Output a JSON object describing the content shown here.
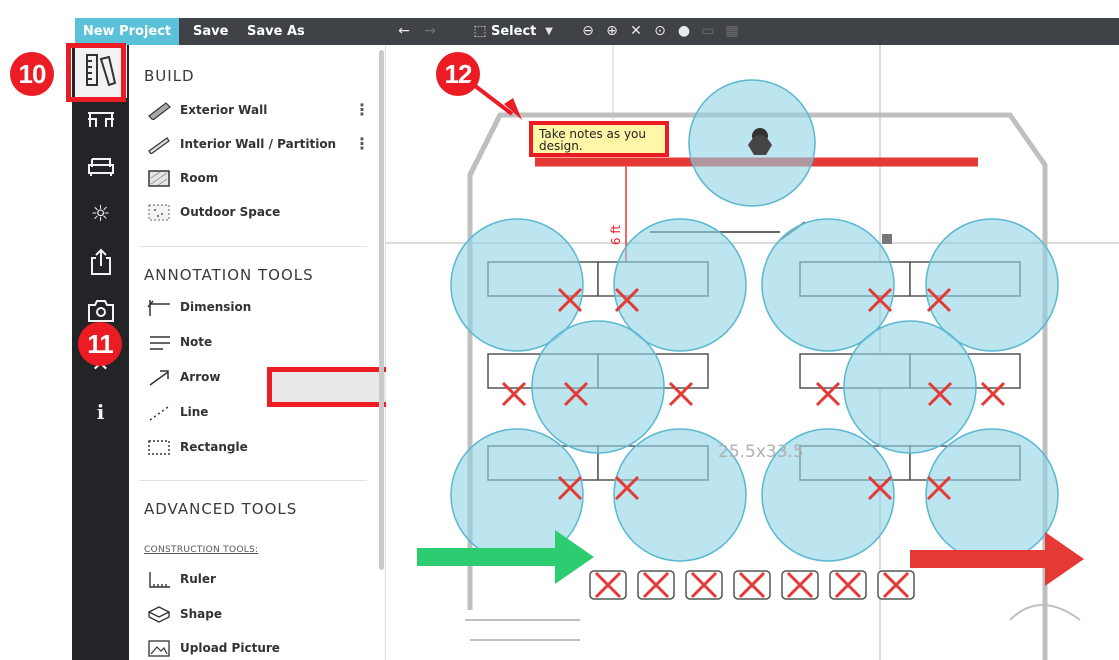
{
  "toolbar": {
    "new_project": "New Project",
    "save": "Save",
    "save_as": "Save As",
    "select": "Select",
    "icons": [
      "undo-icon",
      "redo-icon",
      "select-icon",
      "dropdown-icon",
      "zoom-out-icon",
      "zoom-in-icon",
      "fit-icon",
      "center-icon",
      "layer-icon",
      "copy-icon",
      "grid-icon"
    ]
  },
  "rail": {
    "items": [
      "ruler-pencil-icon",
      "furniture-icon",
      "sofa-icon",
      "light-icon",
      "export-icon",
      "camera-icon",
      "tools-icon",
      "info-icon"
    ]
  },
  "panel": {
    "build_title": "BUILD",
    "build_items": [
      {
        "label": "Exterior Wall",
        "icon": "exterior-wall-icon",
        "more": "⋮"
      },
      {
        "label": "Interior Wall / Partition",
        "icon": "interior-wall-icon",
        "more": "⋮"
      },
      {
        "label": "Room",
        "icon": "room-icon"
      },
      {
        "label": "Outdoor Space",
        "icon": "outdoor-space-icon"
      }
    ],
    "annotation_title": "ANNOTATION TOOLS",
    "annotation_items": [
      {
        "label": "Dimension",
        "icon": "dimension-icon"
      },
      {
        "label": "Note",
        "icon": "note-icon"
      },
      {
        "label": "Arrow",
        "icon": "arrow-icon"
      },
      {
        "label": "Line",
        "icon": "line-icon"
      },
      {
        "label": "Rectangle",
        "icon": "rectangle-icon"
      }
    ],
    "advanced_title": "ADVANCED TOOLS",
    "construction_heading": "CONSTRUCTION TOOLS:",
    "advanced_items": [
      {
        "label": "Ruler",
        "icon": "ruler-icon"
      },
      {
        "label": "Shape",
        "icon": "shape-icon"
      },
      {
        "label": "Upload Picture",
        "icon": "upload-picture-icon"
      }
    ]
  },
  "canvas": {
    "note_text": "Take notes as you design.",
    "dimension_label": "6 ft",
    "room_label": "25.5x33.5"
  },
  "callouts": [
    "10",
    "11",
    "12"
  ],
  "colors": {
    "accent": "#5bc1d8",
    "toolbar": "#3f4247",
    "rail": "#222427",
    "highlight": "#ec1c24",
    "note_fill": "#fff6a8",
    "coverage_circle": "#8fd3e6",
    "arrow_green": "#2ecc71",
    "arrow_red": "#e53935"
  }
}
